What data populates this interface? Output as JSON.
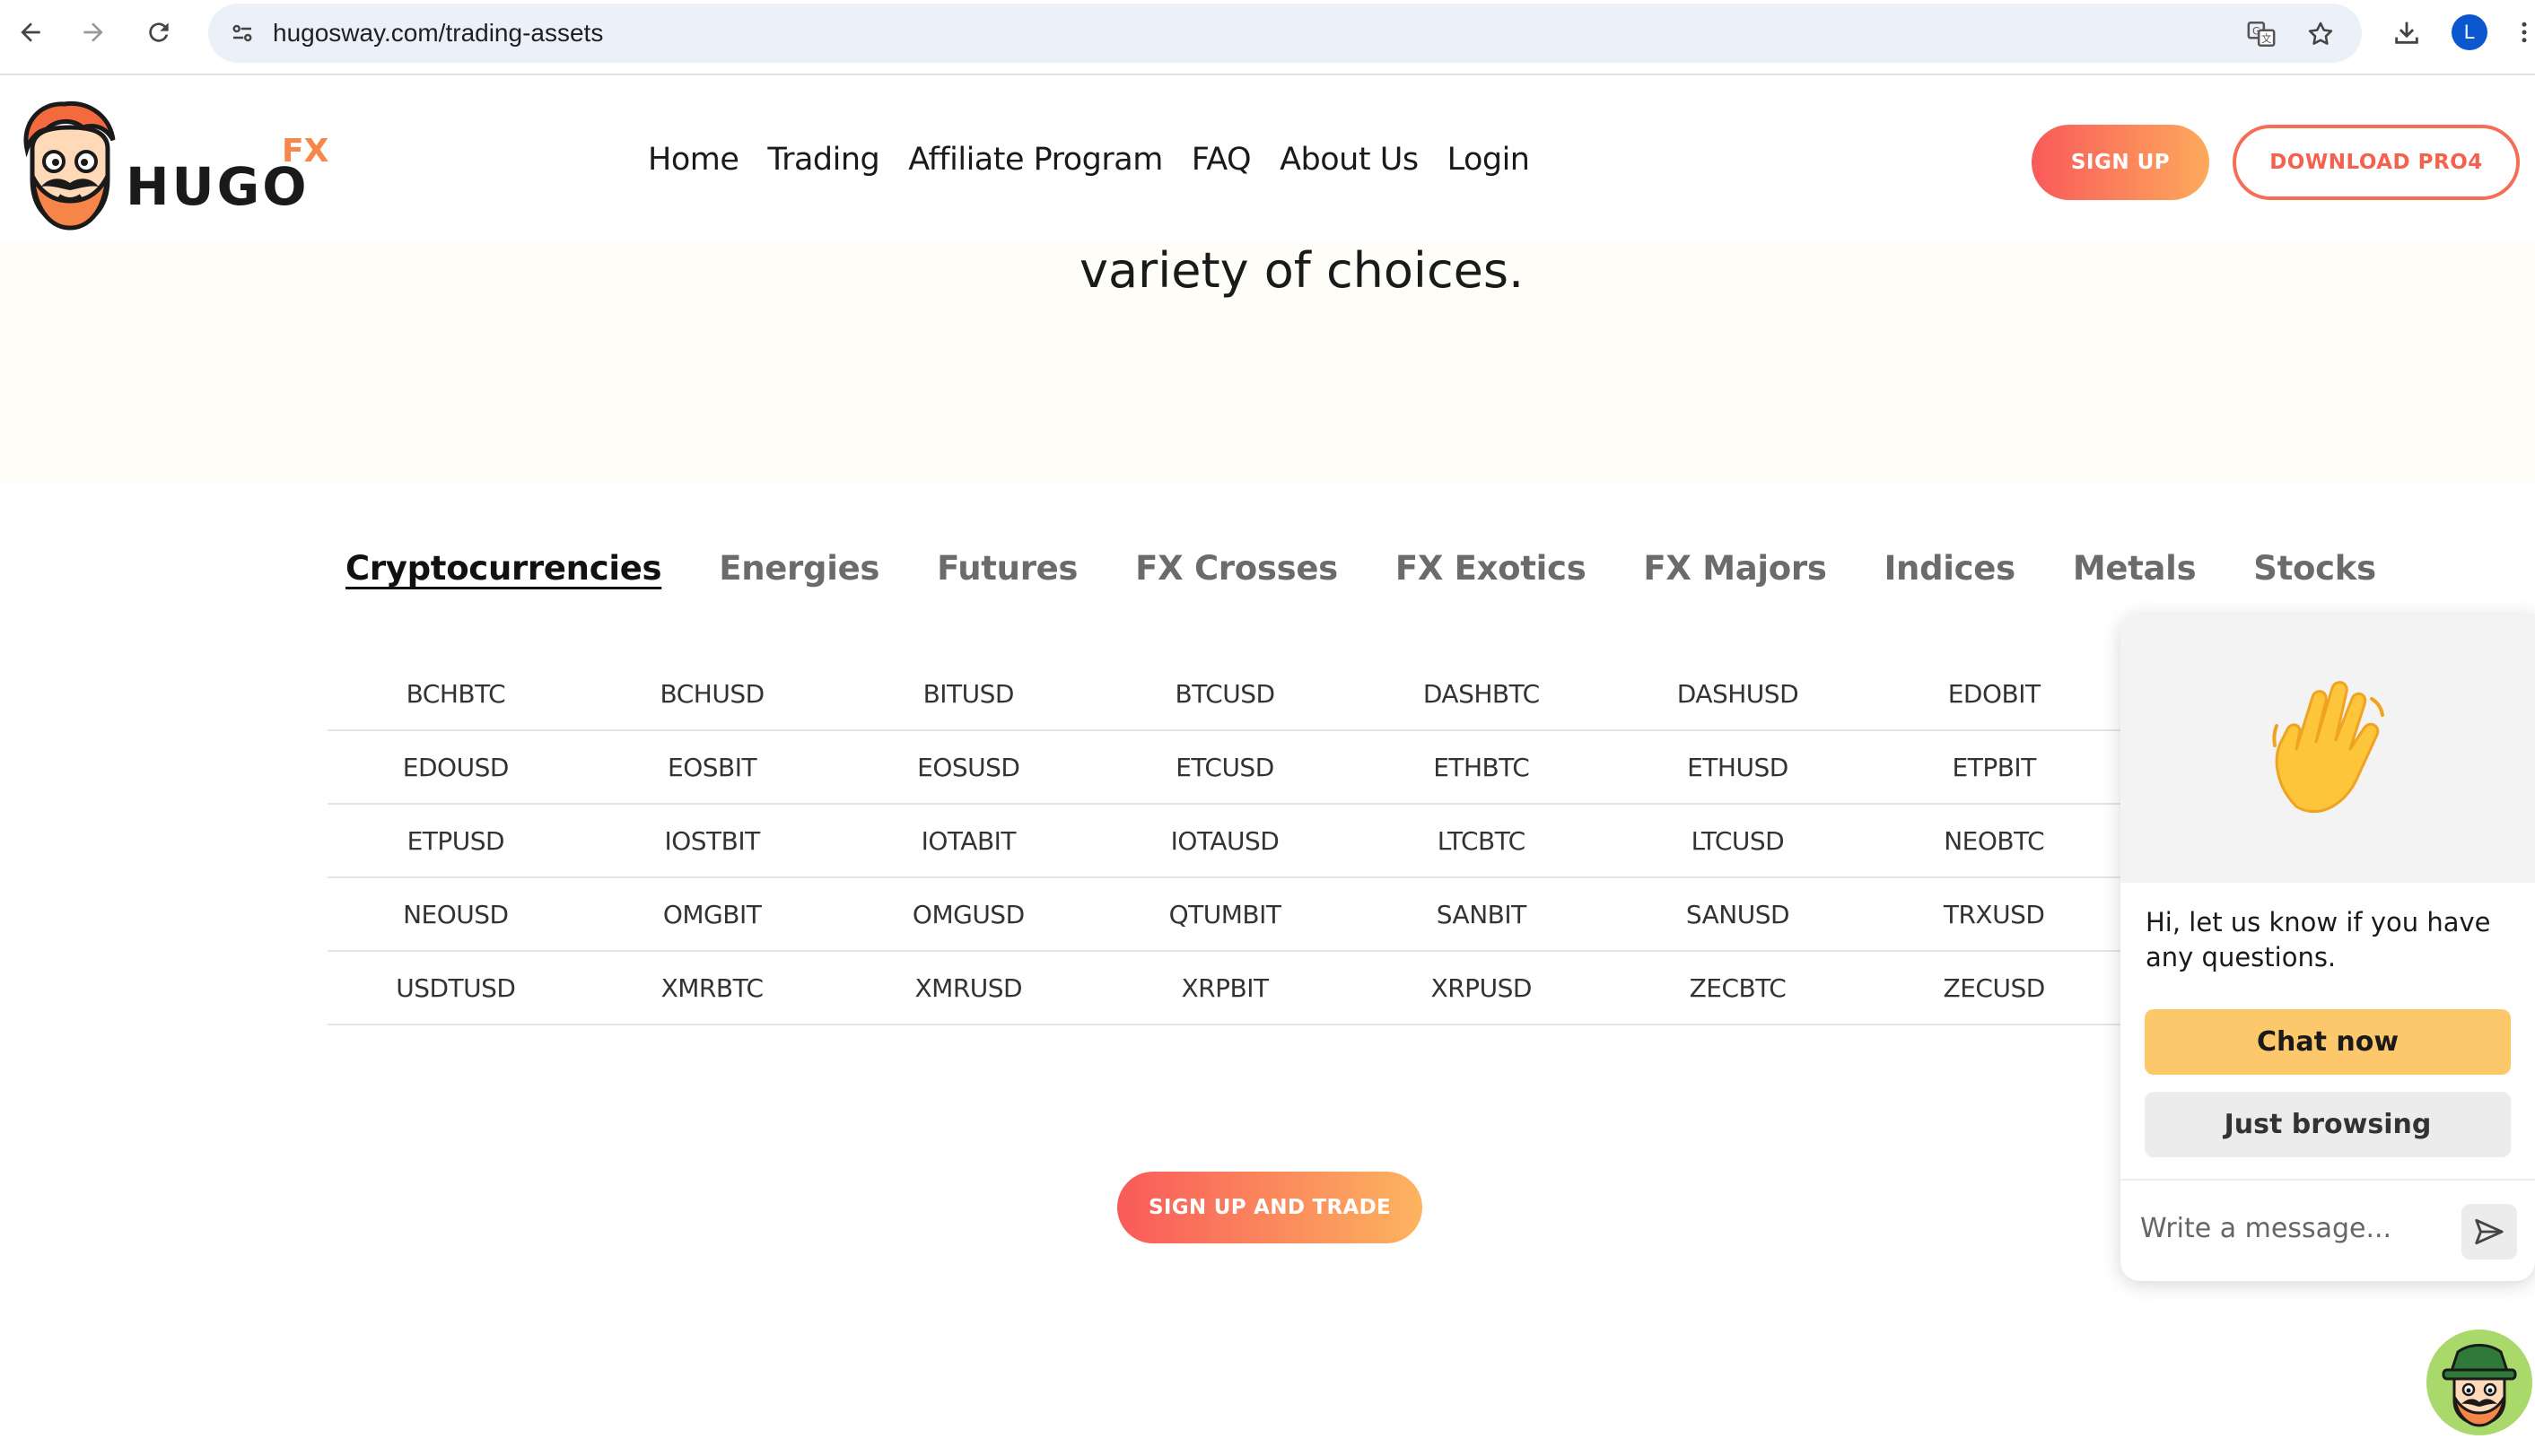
{
  "browser": {
    "url": "hugosway.com/trading-assets",
    "profile_initial": "L",
    "icons": [
      "back-icon",
      "forward-icon",
      "reload-icon",
      "site-info-icon",
      "translate-icon",
      "bookmark-star-icon",
      "download-icon",
      "menu-icon"
    ]
  },
  "header": {
    "logo_text": "HUGO",
    "logo_suffix": "FX",
    "nav": [
      "Home",
      "Trading",
      "Affiliate Program",
      "FAQ",
      "About Us",
      "Login"
    ],
    "signup_label": "SIGN UP",
    "download_label": "DOWNLOAD PRO4"
  },
  "hero": {
    "text": "variety of choices."
  },
  "tabs": {
    "items": [
      "Cryptocurrencies",
      "Energies",
      "Futures",
      "FX Crosses",
      "FX Exotics",
      "FX Majors",
      "Indices",
      "Metals",
      "Stocks"
    ],
    "active": "Cryptocurrencies"
  },
  "assets": {
    "rows": [
      [
        "BCHBTC",
        "BCHUSD",
        "BITUSD",
        "BTCUSD",
        "DASHBTC",
        "DASHUSD",
        "EDOBIT"
      ],
      [
        "EDOUSD",
        "EOSBIT",
        "EOSUSD",
        "ETCUSD",
        "ETHBTC",
        "ETHUSD",
        "ETPBIT"
      ],
      [
        "ETPUSD",
        "IOSTBIT",
        "IOTABIT",
        "IOTAUSD",
        "LTCBTC",
        "LTCUSD",
        "NEOBTC"
      ],
      [
        "NEOUSD",
        "OMGBIT",
        "OMGUSD",
        "QTUMBIT",
        "SANBIT",
        "SANUSD",
        "TRXUSD"
      ],
      [
        "USDTUSD",
        "XMRBTC",
        "XMRUSD",
        "XRPBIT",
        "XRPUSD",
        "ZECBTC",
        "ZECUSD"
      ]
    ]
  },
  "cta": {
    "label": "SIGN UP AND TRADE"
  },
  "chat": {
    "message": "Hi, let us know if you have any questions.",
    "chat_now_label": "Chat now",
    "just_browsing_label": "Just browsing",
    "input_placeholder": "Write a message..."
  },
  "colors": {
    "brand_gradient_start": "#f95a5a",
    "brand_gradient_end": "#fdaa5c",
    "logo_fx": "#f7864a",
    "chat_primary": "#fdc86b",
    "chat_secondary": "#ececec"
  }
}
